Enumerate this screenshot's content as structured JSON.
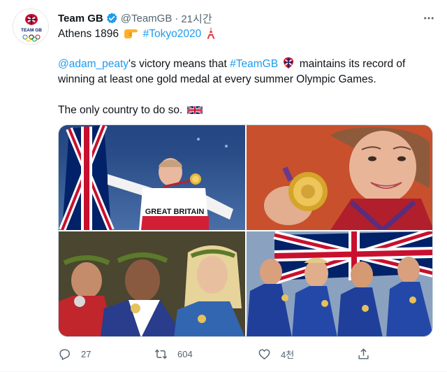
{
  "author": {
    "name": "Team GB",
    "handle": "@TeamGB",
    "separator": "·",
    "time": "21시간",
    "avatar_text": "TEAM GB"
  },
  "tweet": {
    "line1": {
      "text": "Athens 1896",
      "hashtag": "#Tokyo2020"
    },
    "line2": {
      "mention": "@adam_peaty",
      "text_a": "'s victory means that",
      "hashtag": "#TeamGB",
      "text_b": "maintains its record of"
    },
    "line3": "winning at least one gold medal at every summer Olympic Games.",
    "line4": "The only country to do so."
  },
  "media": {
    "photo1_text": "GREAT BRITAIN"
  },
  "actions": {
    "reply_count": "27",
    "retweet_count": "604",
    "like_count": "4천",
    "share_count": ""
  },
  "colors": {
    "link": "#1d9bf0",
    "muted": "#536471",
    "text": "#0f1419"
  }
}
